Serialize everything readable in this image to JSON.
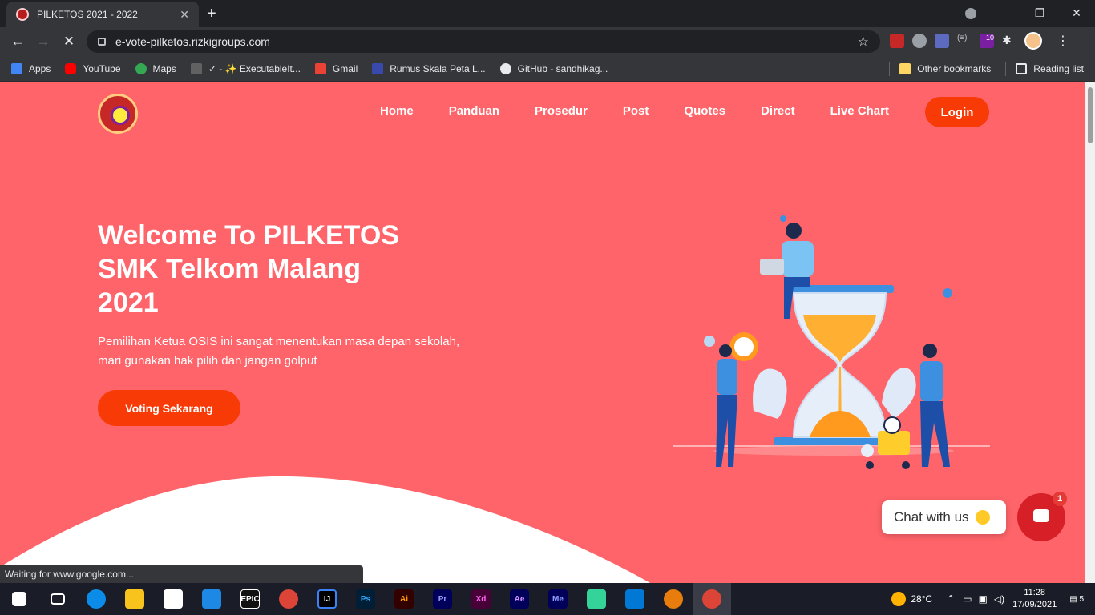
{
  "browser": {
    "tab_title": "PILKETOS 2021 - 2022",
    "url": "e-vote-pilketos.rizkigroups.com",
    "ext_badge": "10",
    "status_text": "Waiting for www.google.com..."
  },
  "bookmarks": {
    "items": [
      "Apps",
      "YouTube",
      "Maps",
      "✓ - ✨ ExecutableIt...",
      "Gmail",
      "Rumus Skala Peta L...",
      "GitHub - sandhikag..."
    ],
    "other": "Other bookmarks",
    "reading": "Reading list"
  },
  "site": {
    "nav": [
      "Home",
      "Panduan",
      "Prosedur",
      "Post",
      "Quotes",
      "Direct",
      "Live Chart"
    ],
    "login": "Login",
    "hero_title_1": "Welcome To PILKETOS",
    "hero_title_2": "SMK Telkom Malang",
    "hero_title_3": "2021",
    "hero_sub_1": "Pemilihan Ketua OSIS ini sangat menentukan masa depan sekolah,",
    "hero_sub_2": "mari gunakan hak pilih dan jangan golput",
    "cta": "Voting Sekarang",
    "chat_label": "Chat with us",
    "chat_badge": "1"
  },
  "taskbar": {
    "temp": "28°C",
    "time": "11:28",
    "date": "17/09/2021",
    "notif_count": "5"
  },
  "colors": {
    "page_bg": "#fe6469",
    "accent": "#f83a07",
    "chat_btn": "#d61f26"
  }
}
